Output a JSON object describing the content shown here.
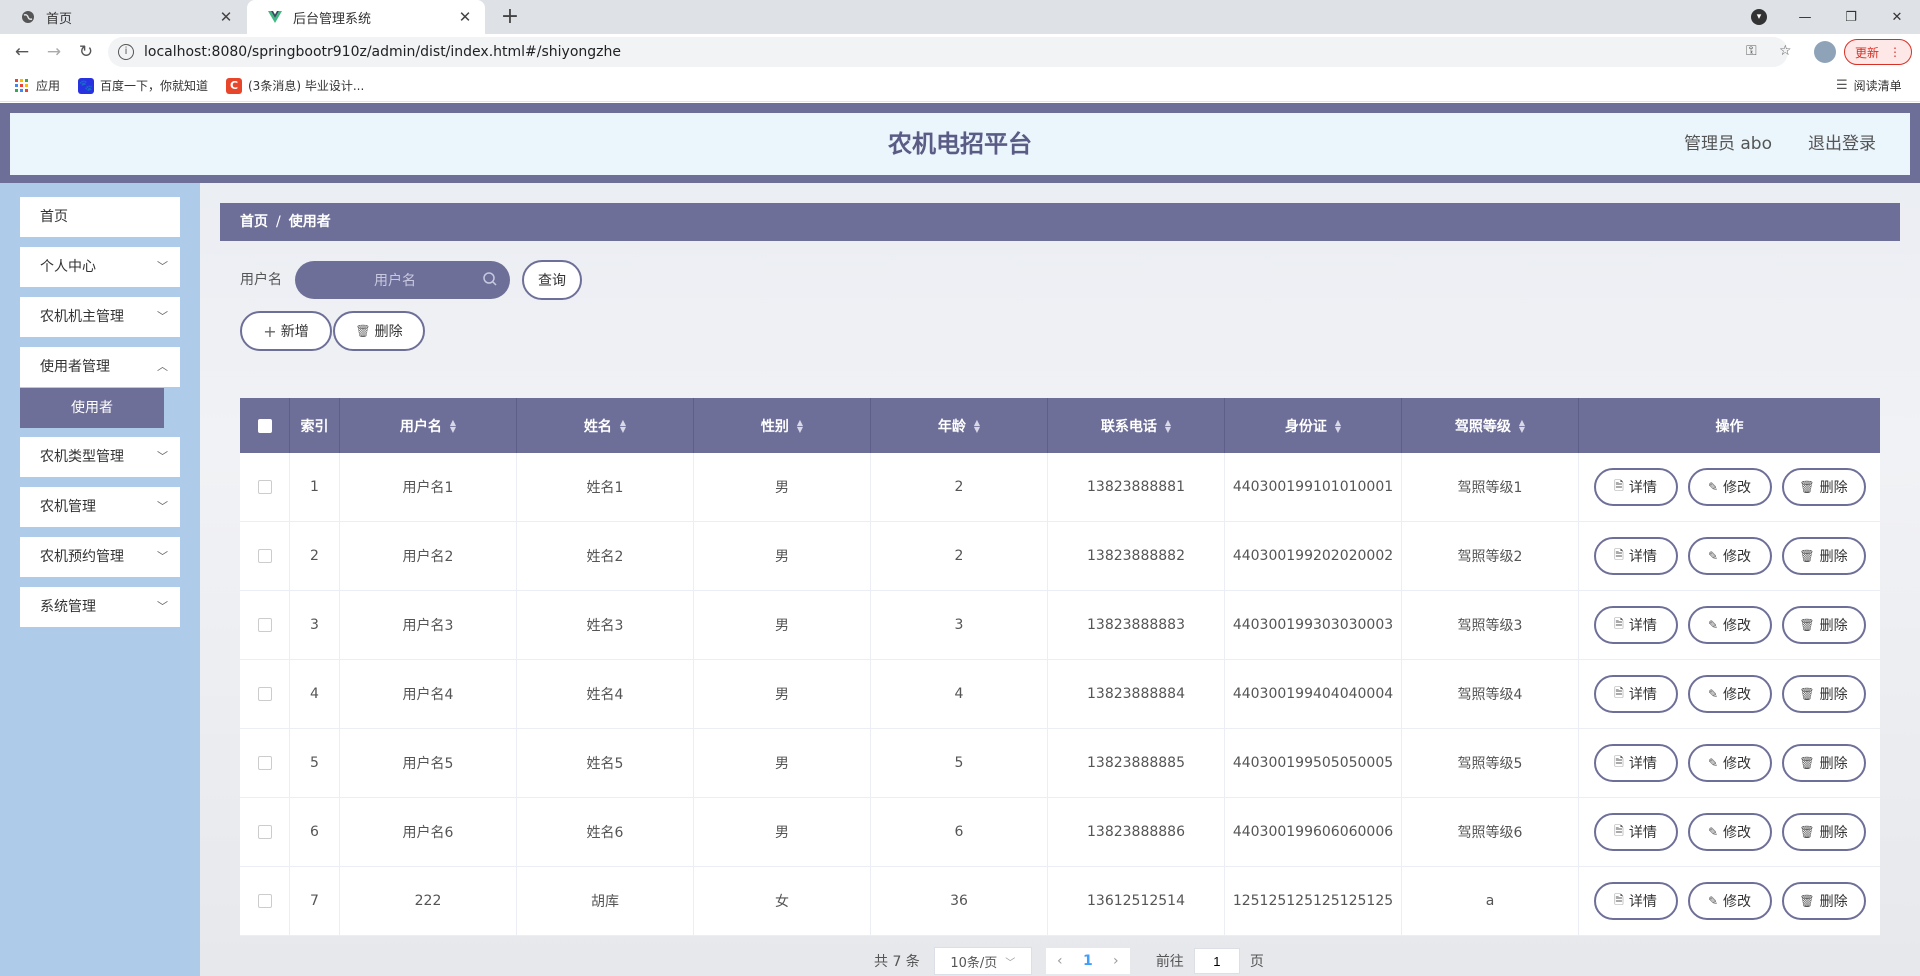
{
  "browser": {
    "tabs": [
      {
        "title": "首页",
        "icon": "globe-icon"
      },
      {
        "title": "后台管理系统",
        "icon": "vue-logo-icon"
      }
    ],
    "url": "localhost:8080/springbootr910z/admin/dist/index.html#/shiyongzhe",
    "update_label": "更新",
    "bookmarks": [
      {
        "label": "应用",
        "icon": "apps-grid-icon"
      },
      {
        "label": "百度一下，你就知道",
        "icon": "baidu-paw-icon"
      },
      {
        "label": "(3条消息) 毕业设计...",
        "icon": "csdn-c-icon"
      }
    ],
    "reading_list": "阅读清单"
  },
  "header": {
    "title": "农机电招平台",
    "user": "管理员 abo",
    "logout": "退出登录"
  },
  "sidebar": {
    "items": [
      {
        "label": "首页",
        "has_children": false
      },
      {
        "label": "个人中心",
        "has_children": true
      },
      {
        "label": "农机机主管理",
        "has_children": true
      },
      {
        "label": "使用者管理",
        "has_children": true,
        "expanded": true
      },
      {
        "label": "农机类型管理",
        "has_children": true
      },
      {
        "label": "农机管理",
        "has_children": true
      },
      {
        "label": "农机预约管理",
        "has_children": true
      },
      {
        "label": "系统管理",
        "has_children": true
      }
    ],
    "active_subitem": "使用者"
  },
  "breadcrumb": {
    "home": "首页",
    "separator": "/",
    "current": "使用者"
  },
  "search": {
    "label": "用户名",
    "placeholder": "用户名",
    "query_button": "查询"
  },
  "actions": {
    "add": "新增",
    "delete": "删除"
  },
  "table": {
    "columns": [
      "索引",
      "用户名",
      "姓名",
      "性别",
      "年龄",
      "联系电话",
      "身份证",
      "驾照等级",
      "操作"
    ],
    "sortable": [
      false,
      true,
      true,
      true,
      true,
      true,
      true,
      true,
      false
    ],
    "rows": [
      {
        "index": "1",
        "username": "用户名1",
        "name": "姓名1",
        "gender": "男",
        "age": "2",
        "phone": "13823888881",
        "idcard": "440300199101010001",
        "license": "驾照等级1"
      },
      {
        "index": "2",
        "username": "用户名2",
        "name": "姓名2",
        "gender": "男",
        "age": "2",
        "phone": "13823888882",
        "idcard": "440300199202020002",
        "license": "驾照等级2"
      },
      {
        "index": "3",
        "username": "用户名3",
        "name": "姓名3",
        "gender": "男",
        "age": "3",
        "phone": "13823888883",
        "idcard": "440300199303030003",
        "license": "驾照等级3"
      },
      {
        "index": "4",
        "username": "用户名4",
        "name": "姓名4",
        "gender": "男",
        "age": "4",
        "phone": "13823888884",
        "idcard": "440300199404040004",
        "license": "驾照等级4"
      },
      {
        "index": "5",
        "username": "用户名5",
        "name": "姓名5",
        "gender": "男",
        "age": "5",
        "phone": "13823888885",
        "idcard": "440300199505050005",
        "license": "驾照等级5"
      },
      {
        "index": "6",
        "username": "用户名6",
        "name": "姓名6",
        "gender": "男",
        "age": "6",
        "phone": "13823888886",
        "idcard": "440300199606060006",
        "license": "驾照等级6"
      },
      {
        "index": "7",
        "username": "222",
        "name": "胡库",
        "gender": "女",
        "age": "36",
        "phone": "13612512514",
        "idcard": "125125125125125125",
        "license": "a"
      }
    ],
    "row_actions": {
      "detail": "详情",
      "edit": "修改",
      "delete": "删除"
    }
  },
  "pagination": {
    "total": "共 7 条",
    "page_size": "10条/页",
    "current_page": "1",
    "goto_prefix": "前往",
    "goto_value": "1",
    "goto_suffix": "页"
  },
  "colors": {
    "accent": "#6e6f98",
    "sidebar_bg": "#afcbea",
    "header_bg": "#eaf5fc"
  }
}
